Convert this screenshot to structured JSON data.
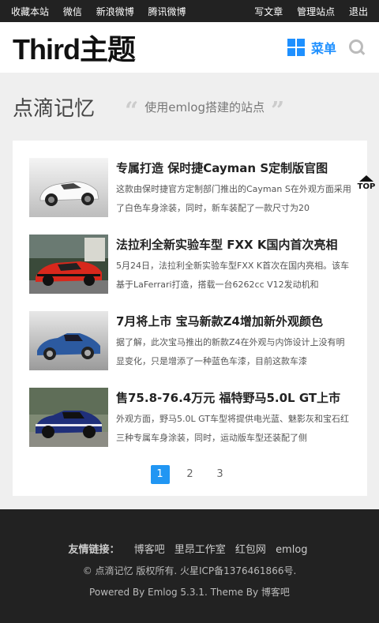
{
  "topbar": {
    "left_links": [
      "收藏本站",
      "微信",
      "新浪微博",
      "腾讯微博"
    ],
    "right_links": [
      "写文章",
      "管理站点",
      "退出"
    ]
  },
  "header": {
    "logo": "Third主题",
    "menu_label": "菜单"
  },
  "banner": {
    "site_name": "点滴记忆",
    "tagline": "使用emlog搭建的站点",
    "quote_open": "“",
    "quote_close": "”"
  },
  "posts": [
    {
      "title": "专属打造 保时捷Cayman S定制版官图",
      "desc": "这款由保时捷官方定制部门推出的Cayman S在外观方面采用了白色车身涂装，同时，新车装配了一款尺寸为20"
    },
    {
      "title": "法拉利全新实验车型 FXX K国内首次亮相",
      "desc": "5月24日，法拉利全新实验车型FXX K首次在国内亮相。该车基于LaFerrari打造，搭载一台6262cc V12发动机和"
    },
    {
      "title": "7月将上市 宝马新款Z4增加新外观颜色",
      "desc": "据了解，此次宝马推出的新款Z4在外观与内饰设计上没有明显变化，只是增添了一种蓝色车漆，目前这款车漆"
    },
    {
      "title": "售75.8-76.4万元 福特野马5.0L GT上市",
      "desc": "外观方面，野马5.0L GT车型将提供电光蓝、魅影灰和宝石红三种专属车身涂装，同时，运动版车型还装配了侧"
    }
  ],
  "pagination": {
    "pages": [
      "1",
      "2",
      "3"
    ],
    "current": "1"
  },
  "back_to_top": "TOP",
  "footer": {
    "links_label": "友情链接：",
    "links": [
      "博客吧",
      "里昂工作室",
      "红包网",
      "emlog"
    ],
    "copyright": "© 点滴记忆 版权所有. 火星ICP备1376461866号.",
    "powered": "Powered By Emlog 5.3.1. Theme By 博客吧"
  },
  "colors": {
    "accent": "#2196f3",
    "topbar_bg": "#222222",
    "footer_bg": "#222222",
    "page_bg": "#efefef"
  }
}
